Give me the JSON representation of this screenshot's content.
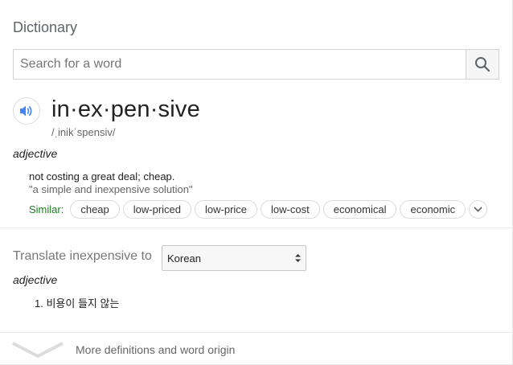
{
  "header": {
    "title": "Dictionary"
  },
  "search": {
    "placeholder": "Search for a word",
    "value": ""
  },
  "entry": {
    "headword": "in·ex·pen·sive",
    "phonetic": "/ˌinikˈspensiv/",
    "part_of_speech": "adjective",
    "definition": "not costing a great deal; cheap.",
    "example": "\"a simple and inexpensive solution\"",
    "similar_label": "Similar:",
    "similar": [
      "cheap",
      "low-priced",
      "low-price",
      "low-cost",
      "economical",
      "economic"
    ]
  },
  "translate": {
    "label": "Translate inexpensive to",
    "language": "Korean",
    "part_of_speech": "adjective",
    "items": [
      "1. 비용이 들지 않는"
    ]
  },
  "footer": {
    "more_label": "More definitions and word origin"
  },
  "colors": {
    "speaker_accent": "#4285f4",
    "similar_label": "#1e7d22"
  },
  "icons": {
    "search": "search-icon",
    "speaker": "speaker-icon",
    "expand": "chevron-down-icon",
    "select": "select-arrows-icon",
    "more": "chevron-down-large-icon"
  }
}
